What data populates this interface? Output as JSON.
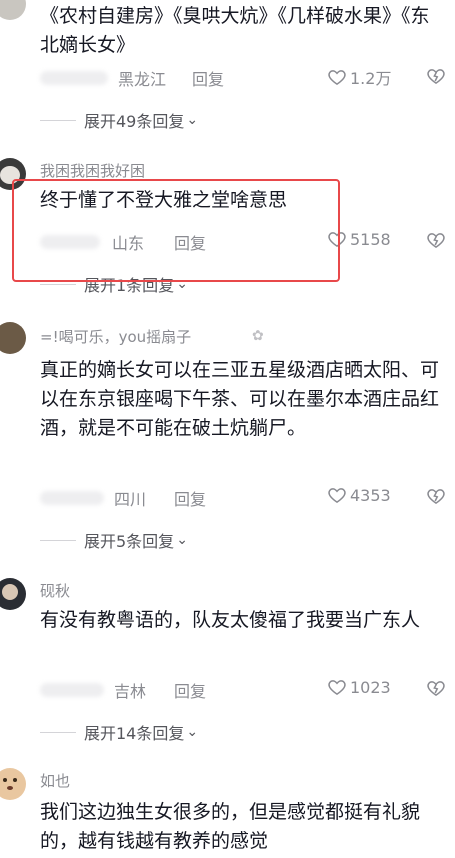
{
  "comments": [
    {
      "text": "《农村自建房》《臭哄大炕》《几样破水果》《东北嫡长女》",
      "location": "黑龙江",
      "reply_label": "回复",
      "likes": "1.2万",
      "expand": "展开49条回复"
    },
    {
      "username": "我困我困我好困",
      "text": "终于懂了不登大雅之堂啥意思",
      "location": "山东",
      "reply_label": "回复",
      "likes": "5158",
      "expand": "展开1条回复"
    },
    {
      "username": "=!喝可乐，",
      "username_tag": "you摇扇子",
      "text": "真正的嫡长女可以在三亚五星级酒店晒太阳、可以在东京银座喝下午茶、可以在墨尔本酒庄品红酒，就是不可能在破土炕躺尸。",
      "location": "四川",
      "reply_label": "回复",
      "likes": "4353",
      "expand": "展开5条回复"
    },
    {
      "username": "砚秋",
      "text": "有没有教粤语的，队友太傻福了我要当广东人",
      "location": "吉林",
      "reply_label": "回复",
      "likes": "1023",
      "expand": "展开14条回复"
    },
    {
      "username": "如也",
      "text": "我们这边独生女很多的，但是感觉都挺有礼貌的，越有钱越有教养的感觉"
    }
  ],
  "colors": {
    "highlight_box": "#e8484a",
    "secondary_text": "#8a8b91",
    "primary_text": "#161823"
  },
  "icons": [
    "heart-outline-icon",
    "dislike-icon",
    "chevron-down-icon"
  ]
}
